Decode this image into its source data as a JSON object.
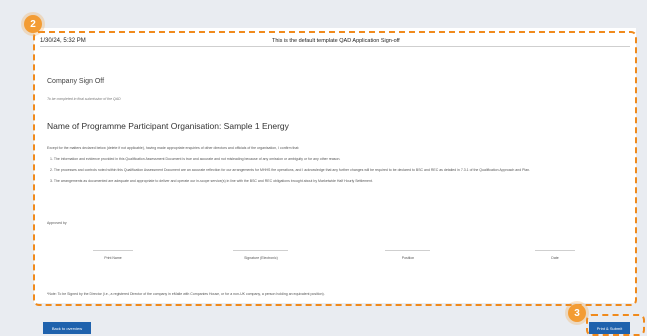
{
  "header": {
    "date": "1/30/24, 5:32 PM",
    "title": "This is the default template QAD Application Sign-off"
  },
  "badges": {
    "main": "2",
    "footer": "3"
  },
  "signoff": {
    "section_title": "Company Sign Off",
    "hint": "To be completed in final submission of the QAD",
    "org_title": "Name of Programme Participant Organisation: Sample 1 Energy",
    "intro": "Except for the matters declared below (delete if not applicable), having made appropriate enquiries of other directors and officials of the organisation, I confirm that:",
    "items": [
      "1. The information and evidence provided in this Qualification Assessment Document is true and accurate and not misleading because of any omission or ambiguity or for any other reason.",
      "2. The processes and controls noted within this Qualification Assessment Document are an accurate reflection for our arrangements for MHHS fire operations, and I acknowledge that any further changes will be required to be declared to BSC and REC as detailed in 7.3.1 of the Qualification Approach and Plan.",
      "3. The arrangements as documented are adequate and appropriate to deliver and operate our in-scope service(s) in line with the BSC and REC obligations brought about by Marketwide Half Hourly Settlement."
    ],
    "approved_by": "Approved by",
    "signature_fields": [
      "Print Name",
      "Signature (Electronic)",
      "Position",
      "Date"
    ],
    "note": "*Note: To be Signed by the Director (i.e., a registered Director of the company in eMalle with Companies House, or for a non-UK company, a person holding an equivalent position)."
  },
  "footer": {
    "back_label": "Back to overview",
    "print_label": "Print & Submit"
  },
  "colors": {
    "accent_orange": "#f08a1c",
    "button_blue": "#1f62ad",
    "page_background": "#e9ecf1"
  }
}
